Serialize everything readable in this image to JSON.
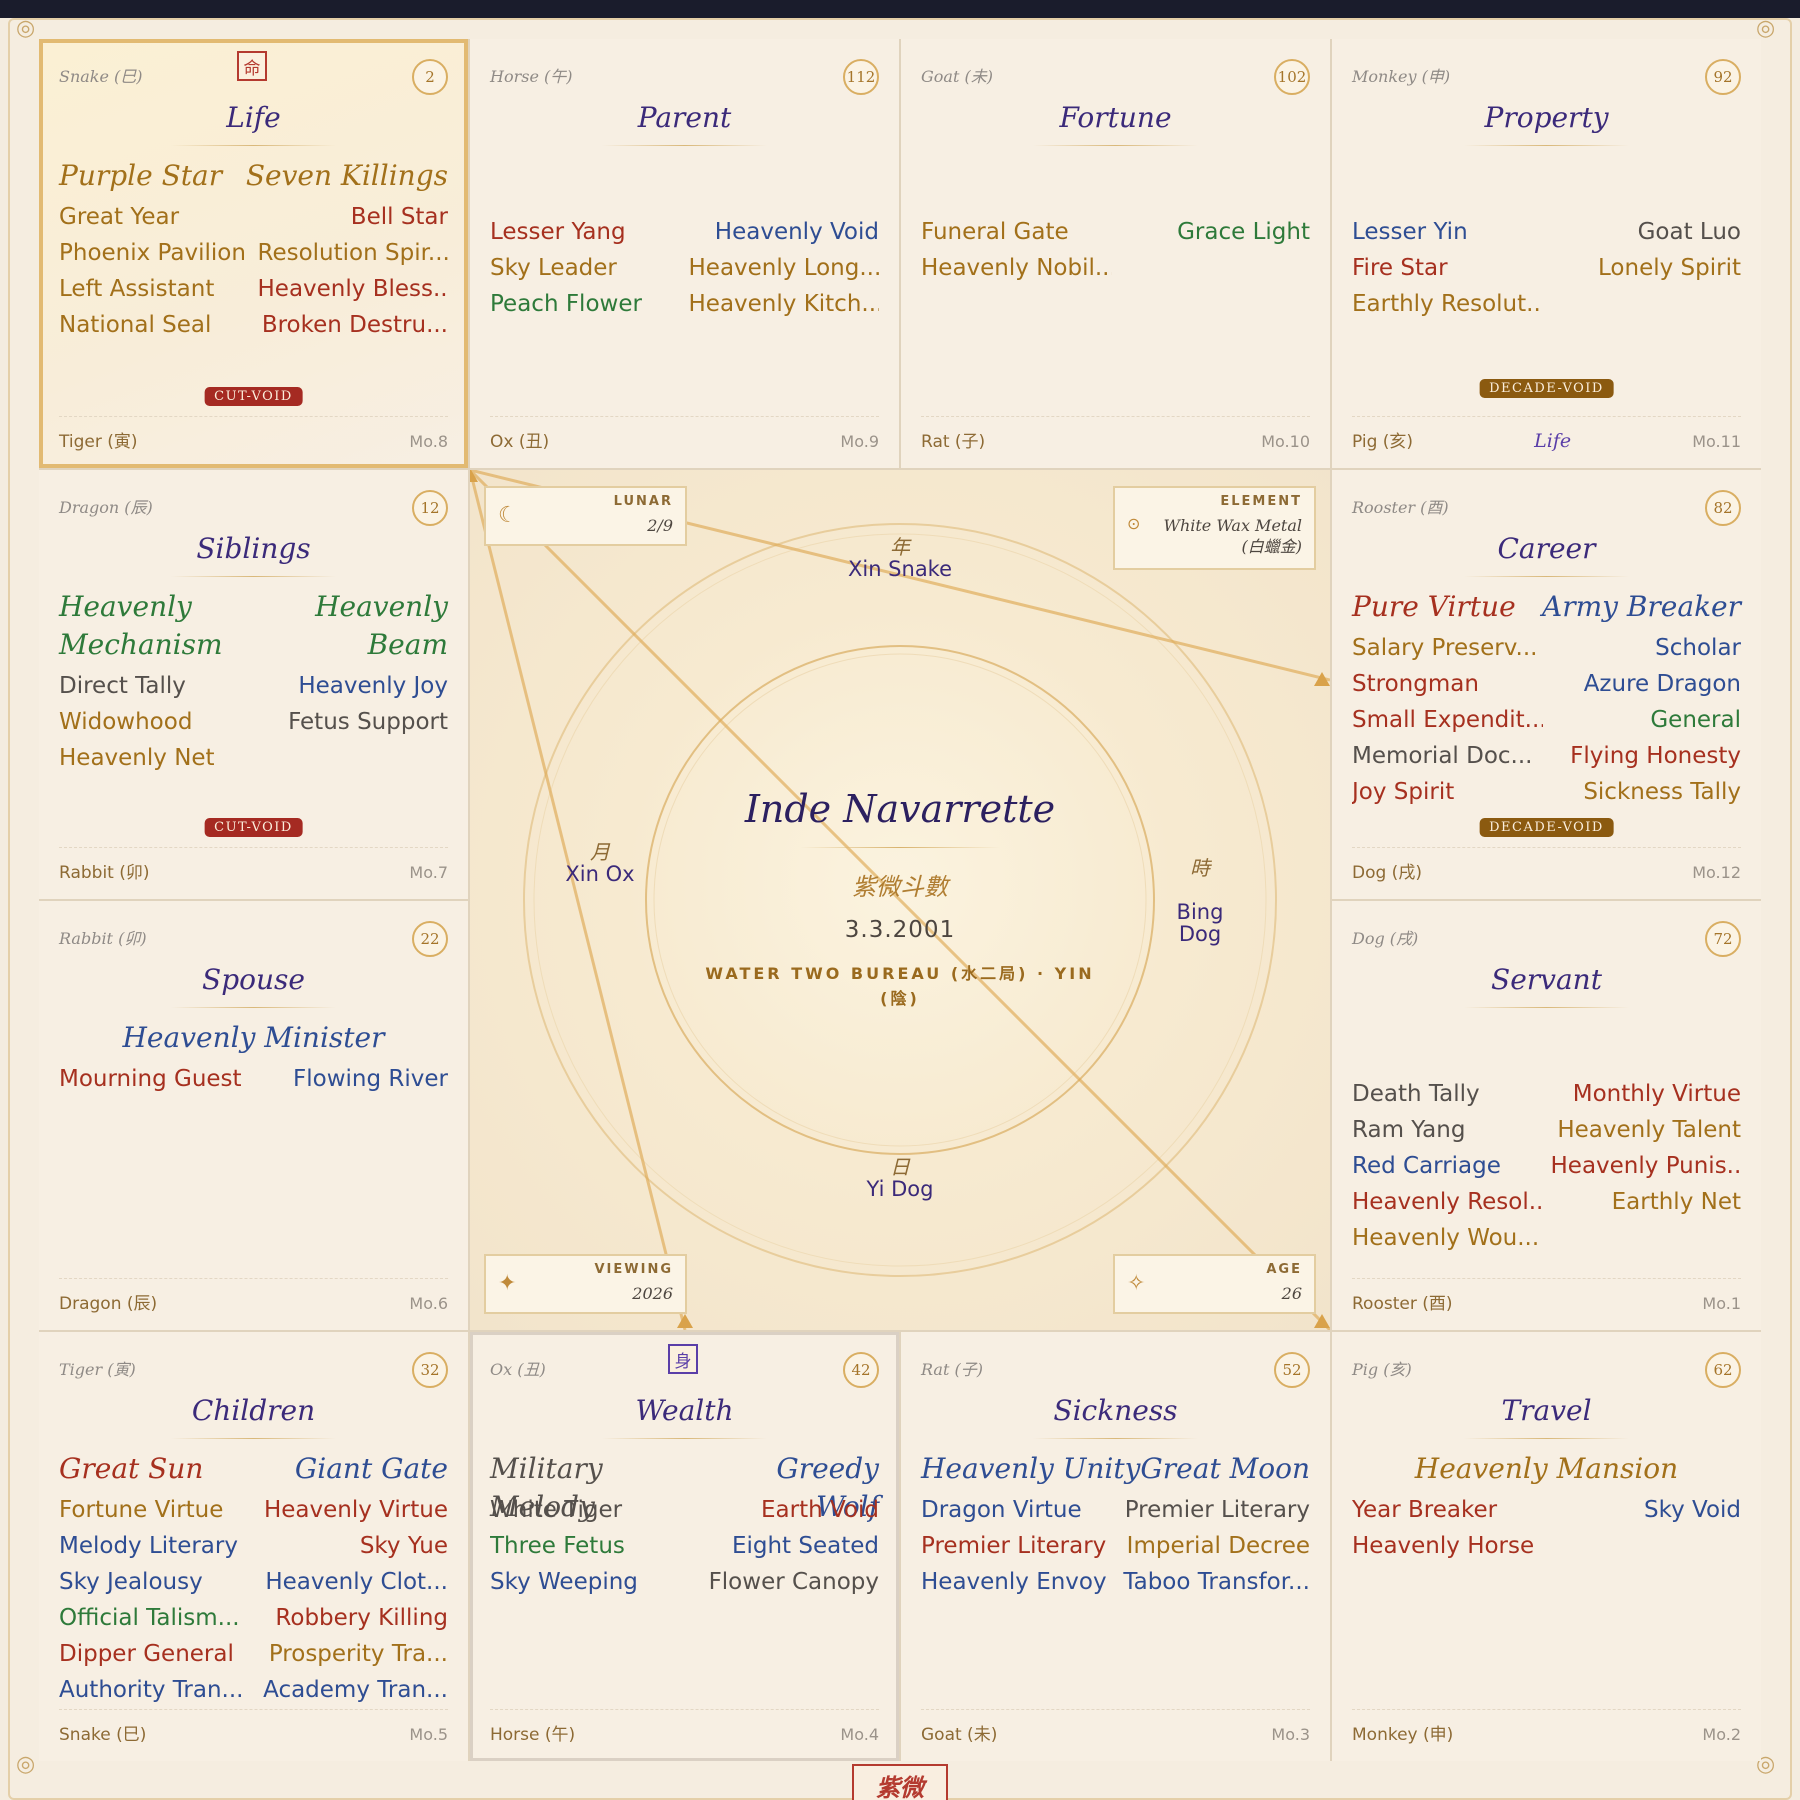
{
  "chart": {
    "owner": "Inde Navarrette",
    "system": "紫微斗數",
    "birth_date": "3.3.2001",
    "bureau": "WATER TWO BUREAU (水二局) · YIN (陰)",
    "footer_seal": "紫微",
    "rings": {
      "year": {
        "cj": "年",
        "label": "Xin Snake"
      },
      "month": {
        "cj": "月",
        "label": "Xin Ox"
      },
      "hour": {
        "cj": "時",
        "label": "Bing\nDog"
      },
      "day": {
        "cj": "日",
        "label": "Yi Dog"
      }
    },
    "info": {
      "lunar": {
        "label": "LUNAR",
        "value": "2/9"
      },
      "element": {
        "label": "ELEMENT",
        "value": "White Wax Metal\n(白蠟金)"
      },
      "viewing": {
        "label": "VIEWING",
        "value": "2026"
      },
      "age": {
        "label": "AGE",
        "value": "26"
      }
    },
    "icons": {
      "lunar": "moon-icon",
      "element": "target-icon",
      "viewing": "sparkle-icon",
      "age": "star-outline-icon"
    }
  },
  "palaces": [
    {
      "key": "life",
      "branch": "Snake (巳)",
      "age": "2",
      "seal": "命",
      "name": "Life",
      "majors": [
        {
          "t": "Purple Star",
          "c": "gold"
        },
        {
          "t": "Seven Killings",
          "c": "gold"
        }
      ],
      "stars": [
        {
          "t": "Great Year",
          "c": "gold"
        },
        {
          "t": "Bell Star",
          "c": "red"
        },
        {
          "t": "Phoenix Pavilion",
          "c": "gold"
        },
        {
          "t": "Resolution Spir...",
          "c": "gold"
        },
        {
          "t": "Left Assistant",
          "c": "gold"
        },
        {
          "t": "Heavenly Bless...",
          "c": "red"
        },
        {
          "t": "National Seal",
          "c": "gold"
        },
        {
          "t": "Broken Destru...",
          "c": "red"
        }
      ],
      "badge": "CUT-VOID",
      "footer": "Tiger (寅)",
      "mo": "Mo.8"
    },
    {
      "key": "parent",
      "branch": "Horse (午)",
      "age": "112",
      "name": "Parent",
      "majors": [],
      "stars": [
        {
          "t": "Lesser Yang",
          "c": "red"
        },
        {
          "t": "Heavenly Void",
          "c": "blue"
        },
        {
          "t": "Sky Leader",
          "c": "gold"
        },
        {
          "t": "Heavenly Long...",
          "c": "gold"
        },
        {
          "t": "Peach Flower",
          "c": "green"
        },
        {
          "t": "Heavenly Kitch...",
          "c": "gold"
        }
      ],
      "footer": "Ox (丑)",
      "mo": "Mo.9"
    },
    {
      "key": "fortune",
      "branch": "Goat (未)",
      "age": "102",
      "name": "Fortune",
      "majors": [],
      "stars": [
        {
          "t": "Funeral Gate",
          "c": "gold"
        },
        {
          "t": "Grace Light",
          "c": "green"
        },
        {
          "t": "Heavenly Nobil...",
          "c": "gold"
        }
      ],
      "footer": "Rat (子)",
      "mo": "Mo.10"
    },
    {
      "key": "property",
      "branch": "Monkey (申)",
      "age": "92",
      "name": "Property",
      "majors": [],
      "stars": [
        {
          "t": "Lesser Yin",
          "c": "blue"
        },
        {
          "t": "Goat Luo",
          "c": "gray"
        },
        {
          "t": "Fire Star",
          "c": "red"
        },
        {
          "t": "Lonely Spirit",
          "c": "gold"
        },
        {
          "t": "Earthly Resolut...",
          "c": "gold"
        }
      ],
      "badge": "DECADE-VOID",
      "footer": "Pig (亥)",
      "decade": "Life",
      "mo": "Mo.11"
    },
    {
      "key": "siblings",
      "branch": "Dragon (辰)",
      "age": "12",
      "name": "Siblings",
      "majors": [
        {
          "t": "Heavenly\nMechanism",
          "c": "green"
        },
        {
          "t": "Heavenly\nBeam",
          "c": "green"
        }
      ],
      "stars": [
        {
          "t": "Direct Tally",
          "c": "gray"
        },
        {
          "t": "Heavenly Joy",
          "c": "blue"
        },
        {
          "t": "Widowhood",
          "c": "gold"
        },
        {
          "t": "Fetus Support",
          "c": "gray"
        },
        {
          "t": "Heavenly Net",
          "c": "gold"
        }
      ],
      "badge": "CUT-VOID",
      "footer": "Rabbit (卯)",
      "mo": "Mo.7"
    },
    {
      "key": "career",
      "branch": "Rooster (酉)",
      "age": "82",
      "name": "Career",
      "majors": [
        {
          "t": "Pure Virtue",
          "c": "red"
        },
        {
          "t": "Army Breaker",
          "c": "blue"
        }
      ],
      "stars": [
        {
          "t": "Salary Preserv...",
          "c": "gold"
        },
        {
          "t": "Scholar",
          "c": "blue"
        },
        {
          "t": "Strongman",
          "c": "red"
        },
        {
          "t": "Azure Dragon",
          "c": "blue"
        },
        {
          "t": "Small Expendit...",
          "c": "red"
        },
        {
          "t": "General",
          "c": "green"
        },
        {
          "t": "Memorial Doc...",
          "c": "gray"
        },
        {
          "t": "Flying Honesty",
          "c": "red"
        },
        {
          "t": "Joy Spirit",
          "c": "red"
        },
        {
          "t": "Sickness Tally",
          "c": "gold"
        }
      ],
      "badge": "DECADE-VOID",
      "footer": "Dog (戌)",
      "mo": "Mo.12"
    },
    {
      "key": "spouse",
      "branch": "Rabbit (卯)",
      "age": "22",
      "name": "Spouse",
      "majors": [
        {
          "t": "Heavenly Minister",
          "c": "blue"
        }
      ],
      "stars": [
        {
          "t": "Mourning Guest",
          "c": "red"
        },
        {
          "t": "Flowing River",
          "c": "blue"
        }
      ],
      "footer": "Dragon (辰)",
      "mo": "Mo.6"
    },
    {
      "key": "servant",
      "branch": "Dog (戌)",
      "age": "72",
      "name": "Servant",
      "majors": [],
      "stars": [
        {
          "t": "Death Tally",
          "c": "gray"
        },
        {
          "t": "Monthly Virtue",
          "c": "red"
        },
        {
          "t": "Ram Yang",
          "c": "gray"
        },
        {
          "t": "Heavenly Talent",
          "c": "gold"
        },
        {
          "t": "Red Carriage",
          "c": "blue"
        },
        {
          "t": "Heavenly Punis...",
          "c": "red"
        },
        {
          "t": "Heavenly Resol...",
          "c": "red"
        },
        {
          "t": "Earthly Net",
          "c": "gold"
        },
        {
          "t": "Heavenly Wou...",
          "c": "gold"
        }
      ],
      "footer": "Rooster (酉)",
      "mo": "Mo.1"
    },
    {
      "key": "children",
      "branch": "Tiger (寅)",
      "age": "32",
      "name": "Children",
      "majors": [
        {
          "t": "Great Sun",
          "c": "red"
        },
        {
          "t": "Giant Gate",
          "c": "blue"
        }
      ],
      "stars": [
        {
          "t": "Fortune Virtue",
          "c": "gold"
        },
        {
          "t": "Heavenly Virtue",
          "c": "red"
        },
        {
          "t": "Melody Literary",
          "c": "blue"
        },
        {
          "t": "Sky Yue",
          "c": "red"
        },
        {
          "t": "Sky Jealousy",
          "c": "blue"
        },
        {
          "t": "Heavenly Clot...",
          "c": "blue"
        },
        {
          "t": "Official Talism...",
          "c": "green"
        },
        {
          "t": "Robbery Killing",
          "c": "red"
        },
        {
          "t": "Dipper General",
          "c": "red"
        },
        {
          "t": "Prosperity Tra...",
          "c": "gold"
        },
        {
          "t": "Authority Tran...",
          "c": "blue"
        },
        {
          "t": "Academy Tran...",
          "c": "blue"
        }
      ],
      "footer": "Snake (巳)",
      "mo": "Mo.5"
    },
    {
      "key": "wealth",
      "branch": "Ox (丑)",
      "age": "42",
      "seal": "身",
      "name": "Wealth",
      "majors": [
        {
          "t": "Military Melody",
          "c": "gray"
        },
        {
          "t": "Greedy Wolf",
          "c": "blue"
        }
      ],
      "stars": [
        {
          "t": "White Tiger",
          "c": "gray"
        },
        {
          "t": "Earth Void",
          "c": "red"
        },
        {
          "t": "Three Fetus",
          "c": "green"
        },
        {
          "t": "Eight Seated",
          "c": "blue"
        },
        {
          "t": "Sky Weeping",
          "c": "blue"
        },
        {
          "t": "Flower Canopy",
          "c": "gray"
        }
      ],
      "footer": "Horse (午)",
      "mo": "Mo.4"
    },
    {
      "key": "sickness",
      "branch": "Rat (子)",
      "age": "52",
      "name": "Sickness",
      "majors": [
        {
          "t": "Heavenly Unity",
          "c": "blue"
        },
        {
          "t": "Great Moon",
          "c": "blue"
        }
      ],
      "stars": [
        {
          "t": "Dragon Virtue",
          "c": "blue"
        },
        {
          "t": "Premier Literary",
          "c": "gray"
        },
        {
          "t": "Premier Literary",
          "c": "red"
        },
        {
          "t": "Imperial Decree",
          "c": "gold"
        },
        {
          "t": "Heavenly Envoy",
          "c": "blue"
        },
        {
          "t": "Taboo Transfor...",
          "c": "blue"
        }
      ],
      "footer": "Goat (未)",
      "mo": "Mo.3"
    },
    {
      "key": "travel",
      "branch": "Pig (亥)",
      "age": "62",
      "name": "Travel",
      "majors": [
        {
          "t": "Heavenly Mansion",
          "c": "gold"
        }
      ],
      "stars": [
        {
          "t": "Year Breaker",
          "c": "red"
        },
        {
          "t": "Sky Void",
          "c": "blue"
        },
        {
          "t": "Heavenly Horse",
          "c": "red"
        }
      ],
      "footer": "Monkey (申)",
      "mo": "Mo.2"
    }
  ]
}
